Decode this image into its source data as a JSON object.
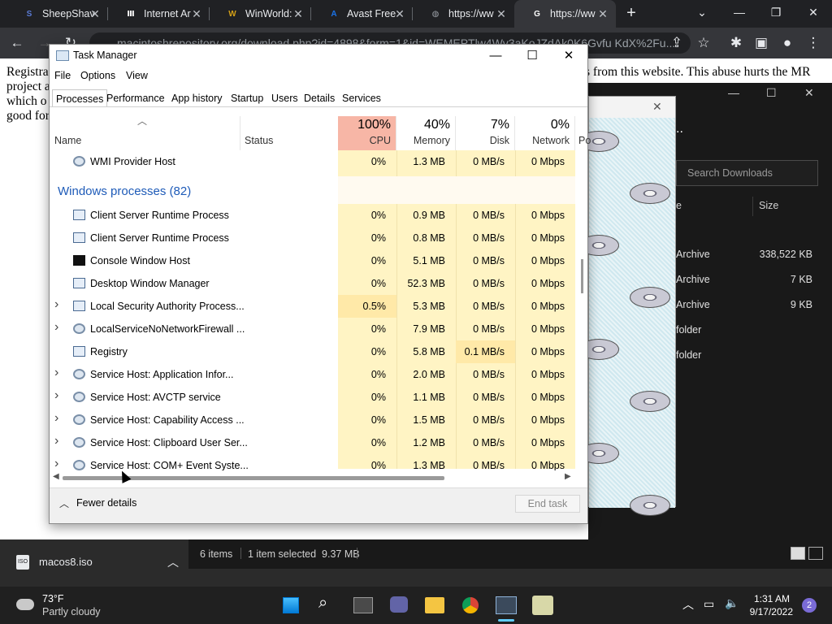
{
  "browser": {
    "tabs": [
      {
        "title": "SheepShav",
        "fav": "S",
        "favcolor": "#5a7bd6"
      },
      {
        "title": "Internet Ar",
        "fav": "Ⅲ",
        "favcolor": "#ffffff"
      },
      {
        "title": "WinWorld:",
        "fav": "W",
        "favcolor": "#d4a017"
      },
      {
        "title": "Avast Free",
        "fav": "A",
        "favcolor": "#1a73e8"
      },
      {
        "title": "https://ww",
        "fav": "◍",
        "favcolor": "#9aa0a6"
      },
      {
        "title": "https://ww",
        "fav": "G",
        "favcolor": "#ffffff"
      }
    ],
    "url": "macintoshrepository.org/download.php?id=4898&form=1&id=WEMEPTlw4Wv3aKoJZdAk0K6Gvfu KdX%2Fu..."
  },
  "webpage": {
    "text_left": "Registra",
    "text_left2": "project a",
    "text_left3": "which o",
    "text_left4": "good for",
    "text_right": "s from this website. This abuse hurts the MR"
  },
  "task_manager": {
    "title": "Task Manager",
    "menu": [
      "File",
      "Options",
      "View"
    ],
    "tabs": [
      "Processes",
      "Performance",
      "App history",
      "Startup",
      "Users",
      "Details",
      "Services"
    ],
    "columns": {
      "name": "Name",
      "status": "Status",
      "cpu_pct": "100%",
      "cpu": "CPU",
      "mem_pct": "40%",
      "mem": "Memory",
      "disk_pct": "7%",
      "disk": "Disk",
      "net_pct": "0%",
      "net": "Network",
      "power": "Po"
    },
    "top_row": {
      "name": "WMI Provider Host",
      "cpu": "0%",
      "mem": "1.3 MB",
      "disk": "0 MB/s",
      "net": "0 Mbps"
    },
    "group_label": "Windows processes (82)",
    "rows": [
      {
        "name": "Client Server Runtime Process",
        "cpu": "0%",
        "mem": "0.9 MB",
        "disk": "0 MB/s",
        "net": "0 Mbps",
        "expand": false,
        "icon": "window"
      },
      {
        "name": "Client Server Runtime Process",
        "cpu": "0%",
        "mem": "0.8 MB",
        "disk": "0 MB/s",
        "net": "0 Mbps",
        "expand": false,
        "icon": "window"
      },
      {
        "name": "Console Window Host",
        "cpu": "0%",
        "mem": "5.1 MB",
        "disk": "0 MB/s",
        "net": "0 Mbps",
        "expand": false,
        "icon": "console"
      },
      {
        "name": "Desktop Window Manager",
        "cpu": "0%",
        "mem": "52.3 MB",
        "disk": "0 MB/s",
        "net": "0 Mbps",
        "expand": false,
        "icon": "window"
      },
      {
        "name": "Local Security Authority Process...",
        "cpu": "0.5%",
        "mem": "5.3 MB",
        "disk": "0 MB/s",
        "net": "0 Mbps",
        "expand": true,
        "icon": "window"
      },
      {
        "name": "LocalServiceNoNetworkFirewall ...",
        "cpu": "0%",
        "mem": "7.9 MB",
        "disk": "0 MB/s",
        "net": "0 Mbps",
        "expand": true,
        "icon": "gear"
      },
      {
        "name": "Registry",
        "cpu": "0%",
        "mem": "5.8 MB",
        "disk": "0.1 MB/s",
        "net": "0 Mbps",
        "expand": false,
        "icon": "window"
      },
      {
        "name": "Service Host: Application Infor...",
        "cpu": "0%",
        "mem": "2.0 MB",
        "disk": "0 MB/s",
        "net": "0 Mbps",
        "expand": true,
        "icon": "gear"
      },
      {
        "name": "Service Host: AVCTP service",
        "cpu": "0%",
        "mem": "1.1 MB",
        "disk": "0 MB/s",
        "net": "0 Mbps",
        "expand": true,
        "icon": "gear"
      },
      {
        "name": "Service Host: Capability Access ...",
        "cpu": "0%",
        "mem": "1.5 MB",
        "disk": "0 MB/s",
        "net": "0 Mbps",
        "expand": true,
        "icon": "gear"
      },
      {
        "name": "Service Host: Clipboard User Ser...",
        "cpu": "0%",
        "mem": "1.2 MB",
        "disk": "0 MB/s",
        "net": "0 Mbps",
        "expand": true,
        "icon": "gear"
      },
      {
        "name": "Service Host: COM+ Event Syste...",
        "cpu": "0%",
        "mem": "1.3 MB",
        "disk": "0 MB/s",
        "net": "0 Mbps",
        "expand": true,
        "icon": "gear"
      }
    ],
    "fewer_details": "Fewer details",
    "end_task": "End task"
  },
  "downloads": {
    "search_placeholder": "Search Downloads",
    "col_name": "e",
    "col_size": "Size",
    "items": [
      {
        "type": "Archive",
        "size": "338,522 KB"
      },
      {
        "type": "Archive",
        "size": "7 KB"
      },
      {
        "type": "Archive",
        "size": "9 KB"
      },
      {
        "type": "folder",
        "size": ""
      },
      {
        "type": "folder",
        "size": ""
      }
    ],
    "status_items": "6 items",
    "status_selected": "1 item selected  9.37 MB"
  },
  "download_shelf": {
    "file": "macos8.iso"
  },
  "taskbar": {
    "temp": "73°F",
    "weather": "Partly cloudy",
    "time": "1:31 AM",
    "date": "9/17/2022",
    "notifications": "2"
  },
  "colors": {
    "cpu_header": "#f7b6a6",
    "cell": "#fff4c4",
    "cell_warm": "#ffe9a8",
    "accent": "#1e5bb8"
  }
}
